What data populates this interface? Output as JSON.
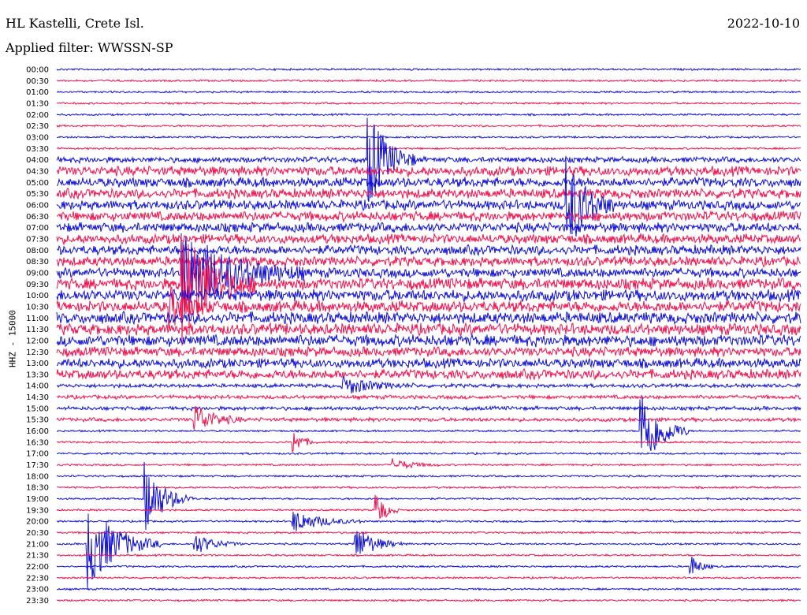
{
  "header": {
    "station": "HL Kastelli, Crete Isl.",
    "filter": "Applied filter: WWSSN-SP",
    "date": "2022-10-10"
  },
  "chart_data": {
    "type": "line",
    "title": "HL Kastelli, Crete Isl.",
    "subtitle": "Applied filter: WWSSN-SP",
    "ylabel": "HHZ - 15000",
    "row_labels": [
      "00:00",
      "00:30",
      "01:00",
      "01:30",
      "02:00",
      "02:30",
      "03:00",
      "03:30",
      "04:00",
      "04:30",
      "05:00",
      "05:30",
      "06:00",
      "06:30",
      "07:00",
      "07:30",
      "08:00",
      "08:30",
      "09:00",
      "09:30",
      "10:00",
      "10:30",
      "11:00",
      "11:30",
      "12:00",
      "12:30",
      "13:00",
      "13:30",
      "14:00",
      "14:30",
      "15:00",
      "15:30",
      "16:00",
      "16:30",
      "17:00",
      "17:30",
      "18:00",
      "18:30",
      "19:00",
      "19:30",
      "20:00",
      "20:30",
      "21:00",
      "21:30",
      "22:00",
      "22:30",
      "23:00",
      "23:30"
    ],
    "trace_colors": [
      "#1010d8",
      "#f0104c"
    ],
    "noise_level": [
      1,
      1,
      1,
      1,
      1,
      1,
      1,
      1,
      3,
      5,
      5,
      5,
      5,
      5,
      5,
      5,
      5,
      5,
      5,
      6,
      6,
      6,
      6,
      6,
      6,
      5,
      5,
      5,
      2,
      2,
      2,
      2,
      1,
      1,
      1,
      1,
      1,
      1,
      1,
      1,
      1,
      1,
      1,
      1,
      1,
      1,
      1,
      1
    ],
    "events": [
      {
        "row": 8,
        "minute": 12.5,
        "amplitude": 70,
        "duration_min": 2
      },
      {
        "row": 12,
        "minute": 20.5,
        "amplitude": 70,
        "duration_min": 2
      },
      {
        "row": 18,
        "minute": 5,
        "amplitude": 60,
        "duration_min": 5
      },
      {
        "row": 19,
        "minute": 5,
        "amplitude": 80,
        "duration_min": 3
      },
      {
        "row": 21,
        "minute": 4.5,
        "amplitude": 25,
        "duration_min": 2
      },
      {
        "row": 28,
        "minute": 11.5,
        "amplitude": 12,
        "duration_min": 3
      },
      {
        "row": 31,
        "minute": 5.5,
        "amplitude": 22,
        "duration_min": 2
      },
      {
        "row": 32,
        "minute": 23.5,
        "amplitude": 65,
        "duration_min": 2
      },
      {
        "row": 33,
        "minute": 9.5,
        "amplitude": 18,
        "duration_min": 1
      },
      {
        "row": 35,
        "minute": 13.5,
        "amplitude": 8,
        "duration_min": 2
      },
      {
        "row": 38,
        "minute": 3.5,
        "amplitude": 50,
        "duration_min": 2
      },
      {
        "row": 39,
        "minute": 12.8,
        "amplitude": 30,
        "duration_min": 1
      },
      {
        "row": 40,
        "minute": 9.5,
        "amplitude": 15,
        "duration_min": 3
      },
      {
        "row": 42,
        "minute": 1.2,
        "amplitude": 60,
        "duration_min": 3
      },
      {
        "row": 42,
        "minute": 5.5,
        "amplitude": 15,
        "duration_min": 2
      },
      {
        "row": 42,
        "minute": 12,
        "amplitude": 25,
        "duration_min": 2
      },
      {
        "row": 44,
        "minute": 25.5,
        "amplitude": 18,
        "duration_min": 1
      }
    ]
  }
}
